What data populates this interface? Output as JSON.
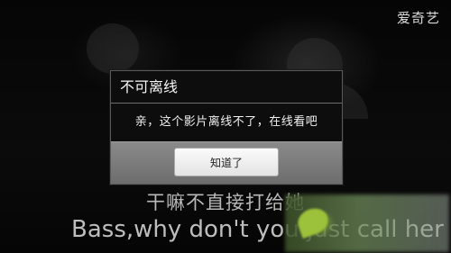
{
  "app": {
    "logo_text": "爱奇艺"
  },
  "subtitles": {
    "chinese": "干嘛不直接打给她",
    "english": "Bass,why don't you just call her"
  },
  "dialog": {
    "title": "不可离线",
    "message": "亲，这个影片离线不了，在线看吧",
    "ok_label": "知道了"
  },
  "colors": {
    "dialog_background": "#0d0d0d",
    "dialog_footer": "#7a7a7a",
    "button_background": "#f0f0f0",
    "subtitle_text": "#bdbdbd"
  }
}
